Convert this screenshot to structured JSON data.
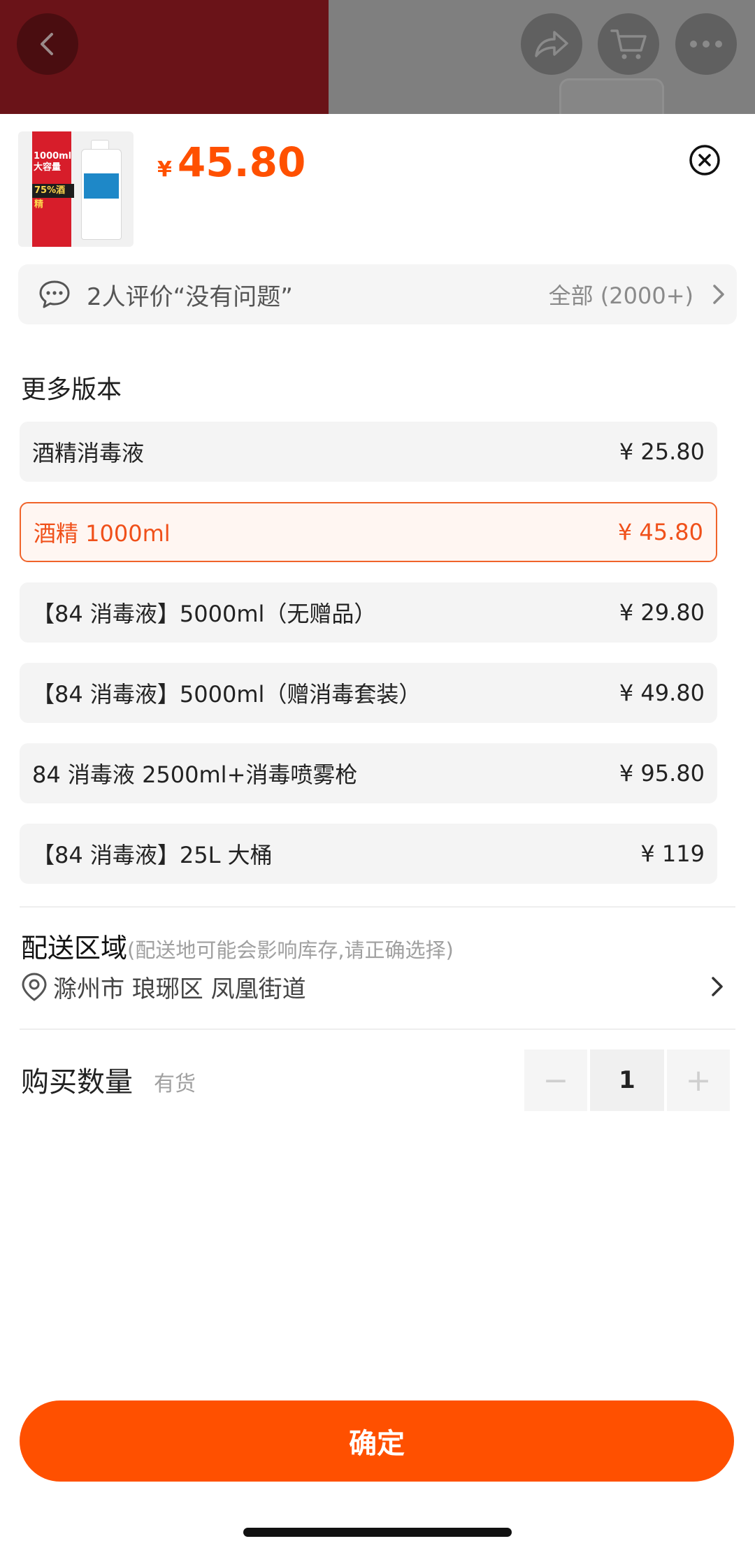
{
  "header": {
    "back_icon": "chevron-left-icon",
    "share_icon": "share-icon",
    "cart_icon": "cart-icon",
    "more_icon": "more-icon"
  },
  "product": {
    "thumb_text_1": "1000ml",
    "thumb_text_2": "大容量",
    "thumb_text_3": "75%酒精",
    "currency": "¥",
    "price": "45.80"
  },
  "review": {
    "text": "2人评价“没有问题”",
    "all_label": "全部 (2000+)"
  },
  "versions": {
    "title": "更多版本",
    "options": [
      {
        "name": "酒精消毒液",
        "price": "¥ 25.80"
      },
      {
        "name": "酒精 1000ml",
        "price": "¥ 45.80"
      },
      {
        "name": "【84 消毒液】5000ml（无赠品）",
        "price": "¥ 29.80"
      },
      {
        "name": "【84 消毒液】5000ml（赠消毒套装）",
        "price": "¥ 49.80"
      },
      {
        "name": "84 消毒液 2500ml+消毒喷雾枪",
        "price": "¥ 95.80"
      },
      {
        "name": "【84 消毒液】25L 大桶",
        "price": "¥ 119"
      }
    ],
    "selected_index": 1
  },
  "delivery": {
    "title": "配送区域",
    "note": "(配送地可能会影响库存,请正确选择)",
    "address": "滁州市  琅琊区  凤凰街道"
  },
  "quantity": {
    "label": "购买数量",
    "stock": "有货",
    "minus": "−",
    "value": "1",
    "plus": "+"
  },
  "confirm_label": "确定",
  "colors": {
    "accent": "#ff5000",
    "selected_text": "#f0501a"
  }
}
